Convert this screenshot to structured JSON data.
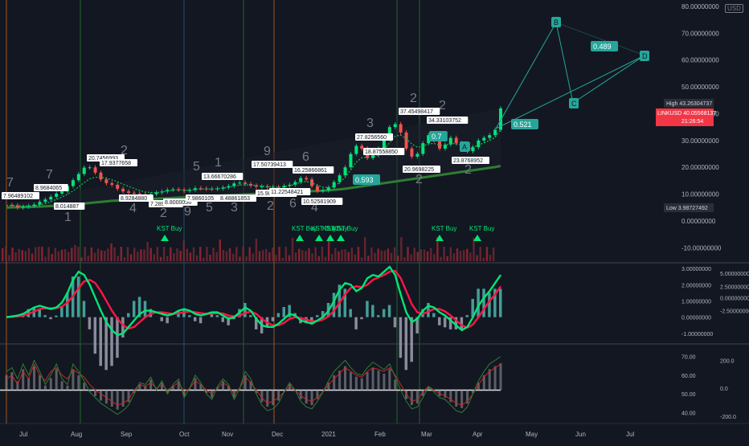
{
  "header": {
    "currency": "USD"
  },
  "price_panel": {
    "axis_labels": [
      "80.00000000",
      "70.00000000",
      "60.00000000",
      "50.00000000",
      "40.00000000",
      "30.00000000",
      "20.00000000",
      "10.00000000",
      "0.00000000",
      "-10.00000000"
    ],
    "tags": {
      "high_label": "High",
      "high_value": "43.26304737",
      "symbol": "LINKUSD",
      "last_value": "40.05568137",
      "countdown": "21:26:54",
      "low_label": "Low",
      "low_value": "3.98727492"
    },
    "pattern_labels": [
      "B",
      "C",
      "D",
      "A"
    ],
    "pattern_ratios": [
      "0.489",
      "0.521",
      "0.593",
      "0.7"
    ],
    "kst_labels": [
      "KST Buy",
      "KST Buy",
      "KST Buy",
      "KST Buy",
      "KST Buy",
      "KST Buy",
      "KST Buy"
    ],
    "wave_numbers": [
      "7",
      "7",
      "1",
      "2",
      "4",
      "2",
      "9",
      "5",
      "5",
      "1",
      "3",
      "9",
      "2",
      "6",
      "6",
      "4",
      "3",
      "2",
      "2",
      "2",
      "2",
      "4"
    ],
    "price_annotations": [
      "7.96489102",
      "8.9684065",
      "8.014887",
      "20.7456993",
      "17.9377658",
      "8.9284880",
      "7.2891193",
      "8.8000056",
      "7.9860105",
      "8.48861853",
      "13.66670286",
      "17.50739413",
      "15.98877011",
      "11.22548421",
      "10.52581909",
      "16.25866861",
      "27.8256560",
      "37.45498417",
      "18.87558850",
      "34.33103752",
      "20.9698225",
      "23.8768952"
    ]
  },
  "chart_data": {
    "type": "line",
    "title": "LINKUSD",
    "x_ticks": [
      "Jul",
      "Aug",
      "Sep",
      "Oct",
      "Nov",
      "Dec",
      "2021",
      "Feb",
      "Mar",
      "Apr",
      "May",
      "Jun",
      "Jul"
    ],
    "price": {
      "ylim": [
        -15,
        80
      ],
      "series_close": [
        6,
        5.8,
        5,
        5.3,
        5.6,
        6.1,
        7.1,
        8,
        9,
        10.2,
        11,
        13,
        15.2,
        17.5,
        19.9,
        20,
        18,
        15.5,
        14.1,
        13.5,
        12,
        11,
        10.5,
        10.2,
        10,
        9.5,
        10,
        10.6,
        11,
        11.6,
        11.8,
        11.6,
        11.2,
        11.6,
        12.2,
        12.1,
        12,
        11.9,
        12.1,
        12.5,
        13,
        14,
        14.3,
        13.8,
        13.2,
        12.8,
        12.9,
        12.5,
        12.7,
        12.5,
        13.1,
        13.5,
        14.5,
        16,
        15.5,
        13,
        11.2,
        11.4,
        12.5,
        14.5,
        17,
        20,
        25,
        28,
        27,
        23.5,
        24.5,
        27,
        31,
        35,
        36.1,
        33,
        27,
        24,
        25,
        29,
        32,
        30,
        27,
        28.5,
        31,
        29,
        27.3,
        26,
        27.5,
        30,
        31,
        32,
        34,
        42
      ],
      "ma_fast": [
        5.8,
        5.8,
        5.7,
        5.6,
        5.6,
        5.7,
        6,
        6.5,
        7.2,
        8,
        8.9,
        9.9,
        11.2,
        12.7,
        14.3,
        15.7,
        16.3,
        16.3,
        15.9,
        15.4,
        14.6,
        13.7,
        12.9,
        12.1,
        11.4,
        10.8,
        10.6,
        10.6,
        10.8,
        11.2,
        11.5,
        11.6,
        11.5,
        11.5,
        11.7,
        11.9,
        11.9,
        11.9,
        12,
        12.2,
        12.5,
        13,
        13.4,
        13.5,
        13.4,
        13.2,
        13,
        12.8,
        12.7,
        12.6,
        12.8,
        13.1,
        13.7,
        14.4,
        14.7,
        14.2,
        13.3,
        12.6,
        12.4,
        13,
        14.3,
        16.3,
        19,
        21.9,
        23.6,
        23.6,
        23.8,
        24.7,
        26.5,
        29.2,
        31.6,
        32,
        30.6,
        28.7,
        27.5,
        27.8,
        28.8,
        28.9,
        28.2,
        28.2,
        28.9,
        28.8,
        28.3,
        27.7,
        27.6,
        28.3,
        29.1,
        30,
        31.2,
        34.1
      ],
      "ma_slow": [
        5,
        5.05,
        5.1,
        5.15,
        5.2,
        5.25,
        5.35,
        5.45,
        5.55,
        5.65,
        5.8,
        5.95,
        6.1,
        6.3,
        6.5,
        6.7,
        6.9,
        7.1,
        7.3,
        7.5,
        7.6,
        7.7,
        7.8,
        7.9,
        8,
        8.1,
        8.2,
        8.3,
        8.4,
        8.5,
        8.6,
        8.7,
        8.8,
        8.9,
        9,
        9.1,
        9.2,
        9.3,
        9.4,
        9.5,
        9.6,
        9.7,
        9.8,
        9.9,
        10,
        10.1,
        10.2,
        10.3,
        10.4,
        10.5,
        10.6,
        10.7,
        10.8,
        10.9,
        11,
        11.1,
        11.2,
        11.3,
        11.4,
        11.6,
        11.8,
        12,
        12.3,
        12.6,
        12.9,
        13.2,
        13.5,
        13.8,
        14.1,
        14.4,
        14.7,
        15,
        15.3,
        15.6,
        15.9,
        16.2,
        16.5,
        16.8,
        17.1,
        17.4,
        17.7,
        18,
        18.3,
        18.6,
        18.9,
        19.2,
        19.5,
        19.8,
        20.1,
        20.5
      ]
    },
    "macd": {
      "ylim": [
        -1.5,
        3.2
      ],
      "axis_labels": [
        "3.00000000",
        "2.00000000",
        "1.00000000",
        "0.00000000",
        "-1.00000000"
      ],
      "right_axis_labels": [
        "5.00000000",
        "2.50000000",
        "0.00000000",
        "-2.50000000"
      ],
      "macd_line": [
        0,
        0.05,
        0.1,
        0.2,
        0.4,
        0.6,
        0.7,
        0.6,
        0.5,
        0.6,
        0.9,
        1.5,
        2.3,
        2.8,
        2.6,
        2,
        1.2,
        0.4,
        -0.3,
        -0.8,
        -1.1,
        -1,
        -0.6,
        -0.2,
        0.2,
        0.4,
        0.4,
        0.3,
        0.2,
        0.1,
        0.2,
        0.4,
        0.5,
        0.4,
        0.2,
        0.1,
        0.2,
        0.3,
        0.3,
        0.1,
        -0.1,
        0,
        0.3,
        0.6,
        0.4,
        -0.1,
        -0.5,
        -0.6,
        -0.6,
        -0.4,
        -0.1,
        0.2,
        0.1,
        -0.2,
        -0.3,
        -0.4,
        -0.2,
        0,
        0.4,
        1,
        1.7,
        2.1,
        2,
        1.6,
        1.8,
        2.4,
        2.6,
        2.5,
        2.8,
        3.1,
        2.6,
        1.4,
        0.3,
        -0.3,
        -0.1,
        0.4,
        0.7,
        0.6,
        0.3,
        0.1,
        -0.2,
        -0.5,
        -0.8,
        -0.6,
        0,
        0.7,
        1.2,
        1.6,
        2.1,
        2.6
      ],
      "signal_line": [
        0,
        0.02,
        0.05,
        0.1,
        0.2,
        0.35,
        0.5,
        0.55,
        0.55,
        0.56,
        0.65,
        0.9,
        1.3,
        1.8,
        2.2,
        2.3,
        2.1,
        1.6,
        1,
        0.4,
        -0.1,
        -0.5,
        -0.7,
        -0.6,
        -0.3,
        0,
        0.2,
        0.3,
        0.3,
        0.25,
        0.2,
        0.25,
        0.3,
        0.35,
        0.3,
        0.25,
        0.2,
        0.22,
        0.25,
        0.22,
        0.1,
        0.05,
        0.1,
        0.25,
        0.35,
        0.2,
        -0.1,
        -0.35,
        -0.5,
        -0.5,
        -0.35,
        -0.1,
        0,
        -0.05,
        -0.15,
        -0.25,
        -0.25,
        -0.15,
        0.05,
        0.4,
        0.9,
        1.4,
        1.8,
        1.9,
        1.85,
        2,
        2.3,
        2.45,
        2.6,
        2.8,
        2.85,
        2.4,
        1.6,
        0.8,
        0.3,
        0.2,
        0.35,
        0.5,
        0.5,
        0.35,
        0.1,
        -0.2,
        -0.5,
        -0.65,
        -0.45,
        0,
        0.5,
        1,
        1.4,
        1.9
      ]
    },
    "oscillator": {
      "ylim": [
        35,
        75
      ],
      "axis_labels": [
        "70.00",
        "60.00",
        "50.00",
        "40.00"
      ],
      "right_axis_labels": [
        "200.0",
        "0.0",
        "-200.0"
      ],
      "red_line": [
        58,
        60,
        55,
        62,
        58,
        66,
        60,
        57,
        62,
        64,
        60,
        58,
        63,
        61,
        59,
        55,
        52,
        50,
        48,
        46,
        44,
        45,
        47,
        52,
        55,
        54,
        56,
        53,
        55,
        52,
        54,
        56,
        51,
        53,
        57,
        55,
        52,
        50,
        53,
        56,
        54,
        50,
        53,
        59,
        56,
        52,
        48,
        45,
        46,
        48,
        51,
        54,
        52,
        49,
        47,
        46,
        48,
        51,
        55,
        58,
        61,
        64,
        62,
        60,
        59,
        62,
        64,
        63,
        62,
        64,
        60,
        55,
        50,
        46,
        47,
        51,
        54,
        52,
        50,
        49,
        47,
        45,
        44,
        46,
        50,
        55,
        59,
        62,
        64,
        66
      ],
      "green_line": [
        62,
        64,
        58,
        66,
        60,
        68,
        62,
        55,
        60,
        66,
        58,
        55,
        66,
        62,
        57,
        51,
        48,
        45,
        43,
        41,
        39,
        41,
        44,
        50,
        56,
        55,
        59,
        52,
        57,
        50,
        55,
        58,
        48,
        53,
        60,
        56,
        50,
        47,
        54,
        58,
        55,
        47,
        53,
        62,
        58,
        50,
        44,
        41,
        42,
        45,
        51,
        56,
        52,
        46,
        43,
        42,
        46,
        51,
        57,
        62,
        65,
        68,
        64,
        61,
        60,
        64,
        67,
        65,
        63,
        66,
        59,
        52,
        46,
        42,
        43,
        48,
        54,
        51,
        48,
        47,
        44,
        41,
        40,
        43,
        50,
        57,
        62,
        66,
        68,
        70
      ]
    }
  }
}
